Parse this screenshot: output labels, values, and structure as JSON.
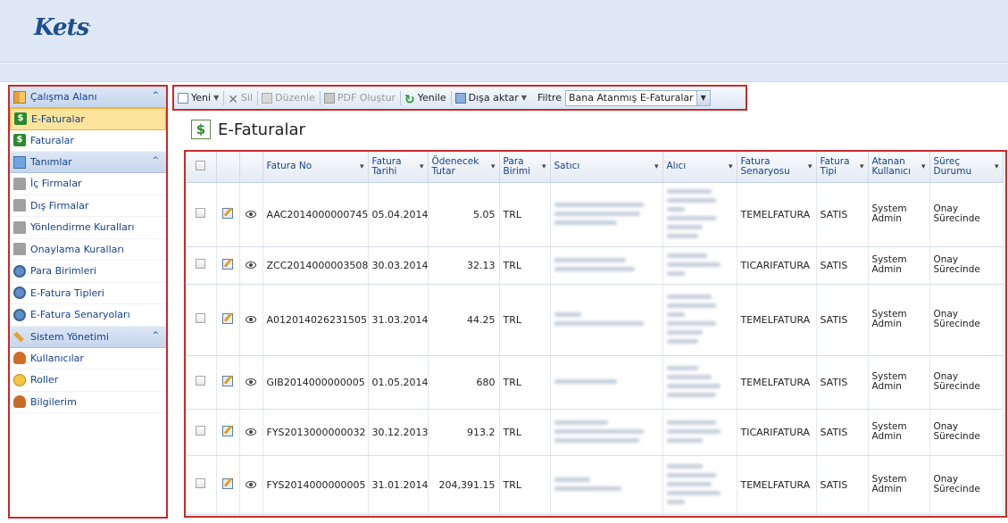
{
  "app": {
    "logo": "Kets",
    "logo_mark": "."
  },
  "sidebar": {
    "sections": [
      {
        "title": "Çalışma Alanı",
        "items": [
          {
            "label": "E-Faturalar",
            "active": true
          },
          {
            "label": "Faturalar"
          }
        ]
      },
      {
        "title": "Tanımlar",
        "items": [
          {
            "label": "İç Firmalar"
          },
          {
            "label": "Dış Firmalar"
          },
          {
            "label": "Yönlendirme Kuralları"
          },
          {
            "label": "Onaylama Kuralları"
          },
          {
            "label": "Para Birimleri"
          },
          {
            "label": "E-Fatura Tipleri"
          },
          {
            "label": "E-Fatura Senaryoları"
          }
        ]
      },
      {
        "title": "Sistem Yönetimi",
        "items": [
          {
            "label": "Kullanıcılar"
          },
          {
            "label": "Roller"
          },
          {
            "label": "Bilgilerim"
          }
        ]
      }
    ]
  },
  "toolbar": {
    "new_label": "Yeni",
    "delete_label": "Sil",
    "edit_label": "Düzenle",
    "pdf_label": "PDF Oluştur",
    "refresh_label": "Yenile",
    "export_label": "Dışa aktar",
    "filter_label": "Filtre",
    "filter_value": "Bana Atanmış E-Faturalar"
  },
  "page": {
    "title": "E-Faturalar",
    "icon": "dollar-icon"
  },
  "grid": {
    "columns": {
      "fatura_no": "Fatura No",
      "fatura_tarihi": "Fatura Tarihi",
      "odenecek_tutar": "Ödenecek Tutar",
      "para_birimi": "Para Birimi",
      "satici": "Satıcı",
      "alici": "Alıcı",
      "senaryo": "Fatura Senaryosu",
      "tipi": "Fatura Tipi",
      "atanan": "Atanan Kullanıcı",
      "durum": "Süreç Durumu"
    },
    "rows": [
      {
        "no": "AAC2014000000745",
        "tarih": "05.04.2014",
        "tutar": "5.05",
        "birim": "TRL",
        "senaryo": "TEMELFATURA",
        "tipi": "SATIS",
        "atanan": "System Admin",
        "durum": "Onay Sürecinde"
      },
      {
        "no": "ZCC2014000003508",
        "tarih": "30.03.2014",
        "tutar": "32.13",
        "birim": "TRL",
        "senaryo": "TICARIFATURA",
        "tipi": "SATIS",
        "atanan": "System Admin",
        "durum": "Onay Sürecinde"
      },
      {
        "no": "A012014026231505",
        "tarih": "31.03.2014",
        "tutar": "44.25",
        "birim": "TRL",
        "senaryo": "TEMELFATURA",
        "tipi": "SATIS",
        "atanan": "System Admin",
        "durum": "Onay Sürecinde"
      },
      {
        "no": "GIB2014000000005",
        "tarih": "01.05.2014",
        "tutar": "680",
        "birim": "TRL",
        "senaryo": "TEMELFATURA",
        "tipi": "SATIS",
        "atanan": "System Admin",
        "durum": "Onay Sürecinde"
      },
      {
        "no": "FYS2013000000032",
        "tarih": "30.12.2013",
        "tutar": "913.2",
        "birim": "TRL",
        "senaryo": "TICARIFATURA",
        "tipi": "SATIS",
        "atanan": "System Admin",
        "durum": "Onay Sürecinde"
      },
      {
        "no": "FYS2014000000005",
        "tarih": "31.01.2014",
        "tutar": "204,391.15",
        "birim": "TRL",
        "senaryo": "TEMELFATURA",
        "tipi": "SATIS",
        "atanan": "System Admin",
        "durum": "Onay Sürecinde"
      }
    ]
  },
  "colors": {
    "accent": "#15428b",
    "highlight": "#c82a2a",
    "active_item": "#fde49c"
  }
}
